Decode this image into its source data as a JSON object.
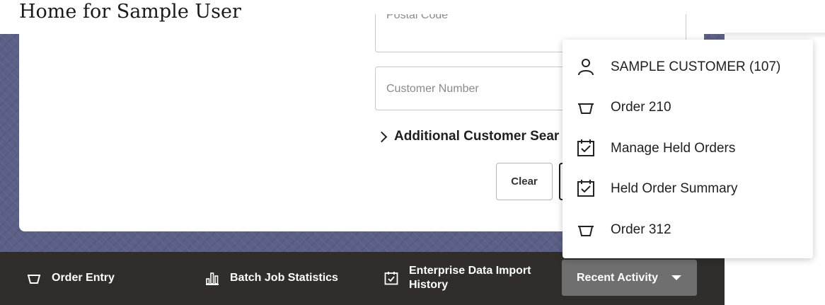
{
  "page": {
    "title": "Home for Sample User"
  },
  "form": {
    "postal_code_placeholder": "Postal Code",
    "customer_number_placeholder": "Customer Number",
    "additional_search_label": "Additional Customer Sear",
    "clear_label": "Clear"
  },
  "footer": {
    "items": [
      {
        "label": "Order Entry",
        "icon": "basket-icon"
      },
      {
        "label": "Batch Job Statistics",
        "icon": "bar-chart-icon"
      },
      {
        "label_line1": "Enterprise Data Import",
        "label_line2": "History",
        "icon": "calendar-check-icon"
      }
    ],
    "recent_activity_label": "Recent Activity"
  },
  "recent_menu": {
    "items": [
      {
        "label": "SAMPLE CUSTOMER (107)",
        "icon": "person-icon"
      },
      {
        "label": "Order 210",
        "icon": "basket-icon"
      },
      {
        "label": "Manage Held Orders",
        "icon": "calendar-check-icon"
      },
      {
        "label": "Held Order Summary",
        "icon": "calendar-check-icon"
      },
      {
        "label": "Order 312",
        "icon": "basket-icon"
      }
    ]
  },
  "colors": {
    "band": "#5c5f86",
    "footer": "#312d2a",
    "recent_button": "#6f6f6f"
  }
}
